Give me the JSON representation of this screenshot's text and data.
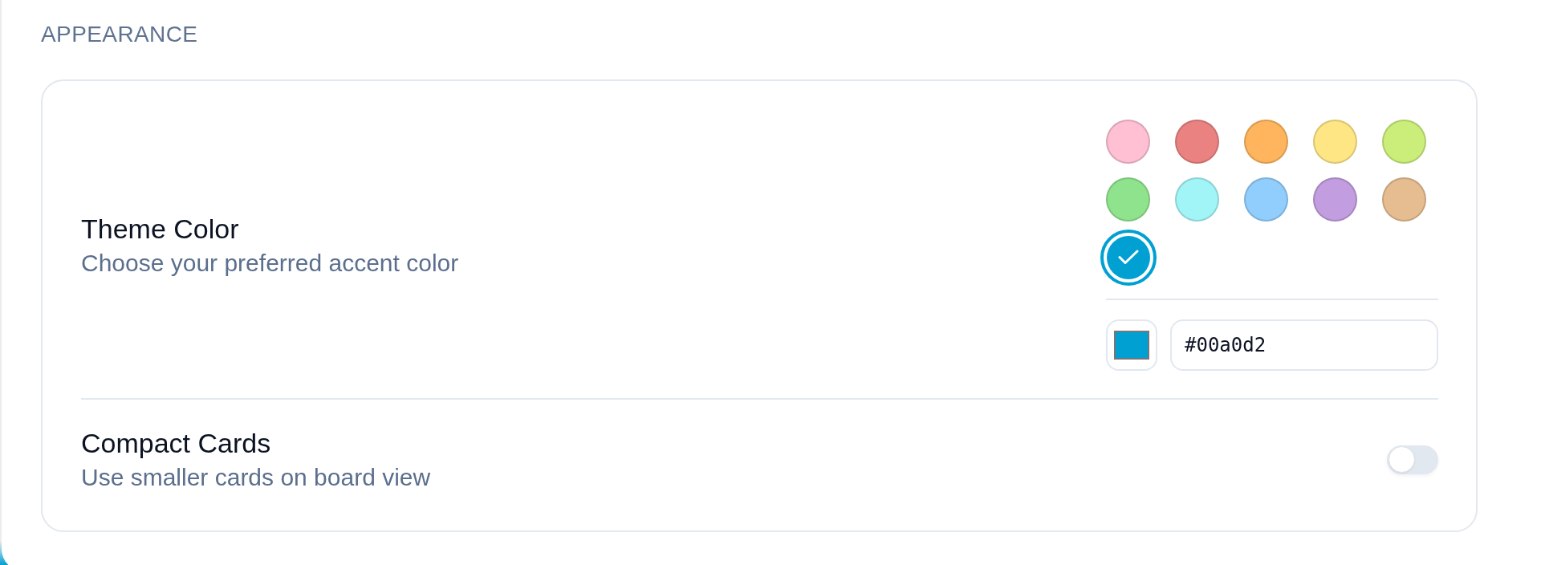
{
  "section": {
    "title": "APPEARANCE"
  },
  "settings": [
    {
      "kind": "color_picker",
      "title": "Theme Color",
      "description": "Choose your preferred accent color",
      "swatches": [
        {
          "color": "#ffc0d4",
          "selected": false
        },
        {
          "color": "#eb8282",
          "selected": false
        },
        {
          "color": "#feb55d",
          "selected": false
        },
        {
          "color": "#ffe685",
          "selected": false
        },
        {
          "color": "#cbee7b",
          "selected": false
        },
        {
          "color": "#90e38d",
          "selected": false
        },
        {
          "color": "#a2f5f7",
          "selected": false
        },
        {
          "color": "#91cefd",
          "selected": false
        },
        {
          "color": "#c29ddf",
          "selected": false
        },
        {
          "color": "#e6bd91",
          "selected": false
        },
        {
          "color": "#00a0d2",
          "selected": true
        }
      ],
      "custom_color": {
        "value": "#00a0d2"
      }
    },
    {
      "kind": "toggle",
      "title": "Compact Cards",
      "description": "Use smaller cards on board view",
      "on": false
    }
  ]
}
